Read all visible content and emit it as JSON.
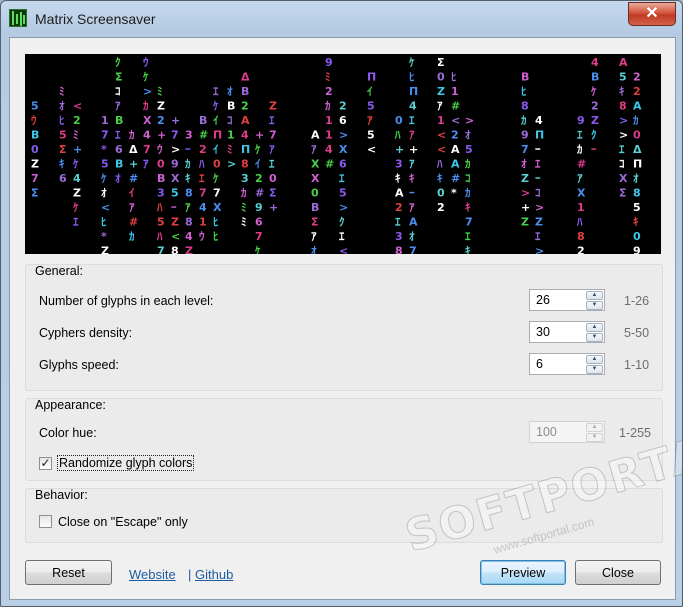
{
  "window": {
    "title": "Matrix Screensaver",
    "close_symbol": "✕"
  },
  "preview": {
    "glyph_palette": [
      "#d060d0",
      "#e03a8c",
      "#4a8ef0",
      "#47d047",
      "#8a5af0",
      "#e04040",
      "#5ad0d0",
      "#ffffff",
      "#3bc8e8",
      "#9b6bd8"
    ],
    "glyph_set": "ｱｲｳｴｵｶｷｸｹｺ0123456789ABXZΣΔΠ<>#*+ﾊﾐﾋｰ"
  },
  "general": {
    "title": "General:",
    "rows": [
      {
        "label": "Number of glyphs in each level:",
        "value": "26",
        "range": "1-26"
      },
      {
        "label": "Cyphers density:",
        "value": "30",
        "range": "5-50"
      },
      {
        "label": "Glyphs speed:",
        "value": "6",
        "range": "1-10"
      }
    ]
  },
  "appearance": {
    "title": "Appearance:",
    "hue_label": "Color hue:",
    "hue_value": "100",
    "hue_range": "1-255",
    "randomize_label": "Randomize glyph colors",
    "randomize_checked": true,
    "check_mark": "✓"
  },
  "behavior": {
    "title": "Behavior:",
    "escape_label": "Close on \"Escape\" only",
    "escape_checked": false
  },
  "footer": {
    "reset_label": "Reset",
    "website_label": "Website",
    "separator": "|",
    "github_label": "Github",
    "preview_label": "Preview",
    "close_label": "Close"
  },
  "watermark": {
    "main": "SOFTPORTAL",
    "sub": "www.softportal.com"
  }
}
